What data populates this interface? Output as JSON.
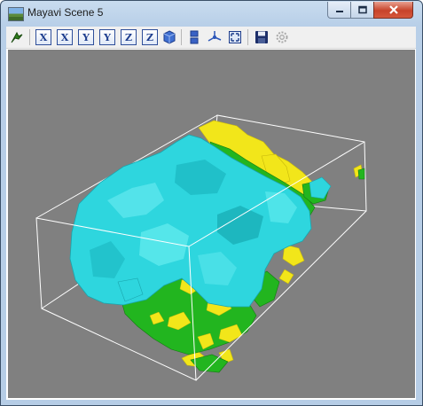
{
  "window": {
    "title": "Mayavi Scene 5",
    "controls": {
      "minimize_icon": "minimize-icon",
      "maximize_icon": "maximize-icon",
      "close_icon": "close-icon"
    }
  },
  "toolbar": {
    "buttons": [
      {
        "id": "mayavi-pipeline",
        "icon": "mayavi-pipeline-icon"
      },
      {
        "id": "view-x-minus",
        "label": "X"
      },
      {
        "id": "view-x-plus",
        "label": "X"
      },
      {
        "id": "view-y-minus",
        "label": "Y"
      },
      {
        "id": "view-y-plus",
        "label": "Y"
      },
      {
        "id": "view-z-minus",
        "label": "Z"
      },
      {
        "id": "view-z-plus",
        "label": "Z"
      },
      {
        "id": "isometric-view",
        "icon": "cube-icon"
      },
      {
        "id": "parallel-projection",
        "icon": "parallel-projection-icon"
      },
      {
        "id": "toggle-axes",
        "icon": "axes-icon"
      },
      {
        "id": "full-screen",
        "icon": "fullscreen-icon"
      },
      {
        "id": "save",
        "icon": "floppy-disk-icon"
      },
      {
        "id": "configure",
        "icon": "gear-icon"
      }
    ]
  },
  "scene": {
    "background": "#808080",
    "colors": {
      "outline": "#ffffff",
      "cyan": "#2ed6de",
      "green": "#22b51f",
      "yellow": "#f2e61a"
    }
  }
}
